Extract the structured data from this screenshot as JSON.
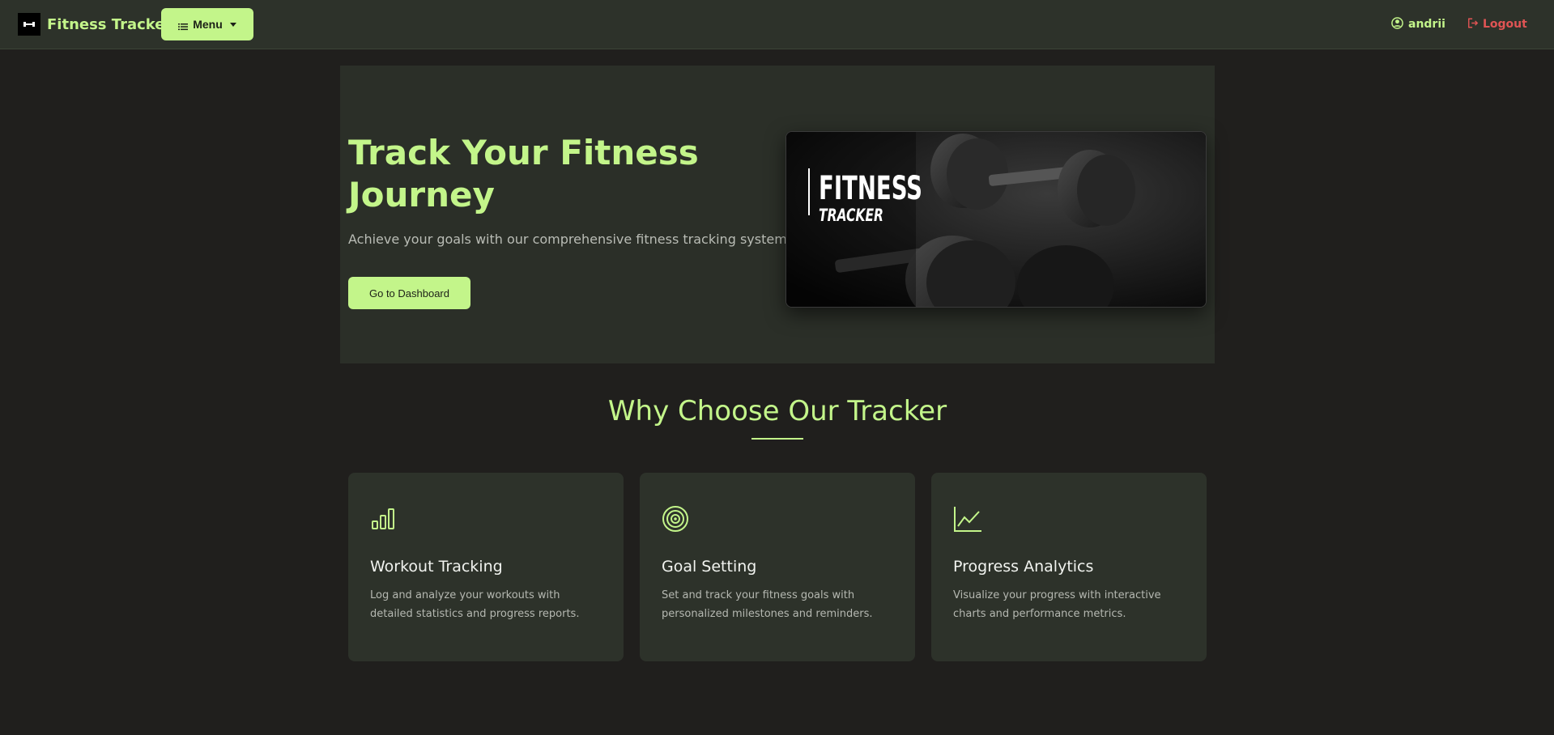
{
  "navbar": {
    "brand": "Fitness Tracker",
    "brand_logo_icon": "dumbbell-icon",
    "menu_label": "Menu",
    "user_name": "andrii",
    "logout_label": "Logout"
  },
  "hero": {
    "title_line1": "Track Your Fitness",
    "title_line2": "Journey",
    "subtitle": "Achieve your goals with our comprehensive fitness tracking system",
    "cta_label": "Go to Dashboard",
    "image": {
      "title": "FITNESS",
      "subtitle": "TRACKER"
    }
  },
  "features": {
    "title": "Why Choose Our Tracker",
    "cards": [
      {
        "icon": "bar-chart-icon",
        "title": "Workout Tracking",
        "text": "Log and analyze your workouts with detailed statistics and progress reports."
      },
      {
        "icon": "target-icon",
        "title": "Goal Setting",
        "text": "Set and track your fitness goals with personalized milestones and reminders."
      },
      {
        "icon": "line-chart-icon",
        "title": "Progress Analytics",
        "text": "Visualize your progress with interactive charts and performance metrics."
      }
    ]
  },
  "colors": {
    "accent": "#c3f58a",
    "background": "#201f1d",
    "surface": "#2d322a",
    "danger": "#e05454"
  }
}
